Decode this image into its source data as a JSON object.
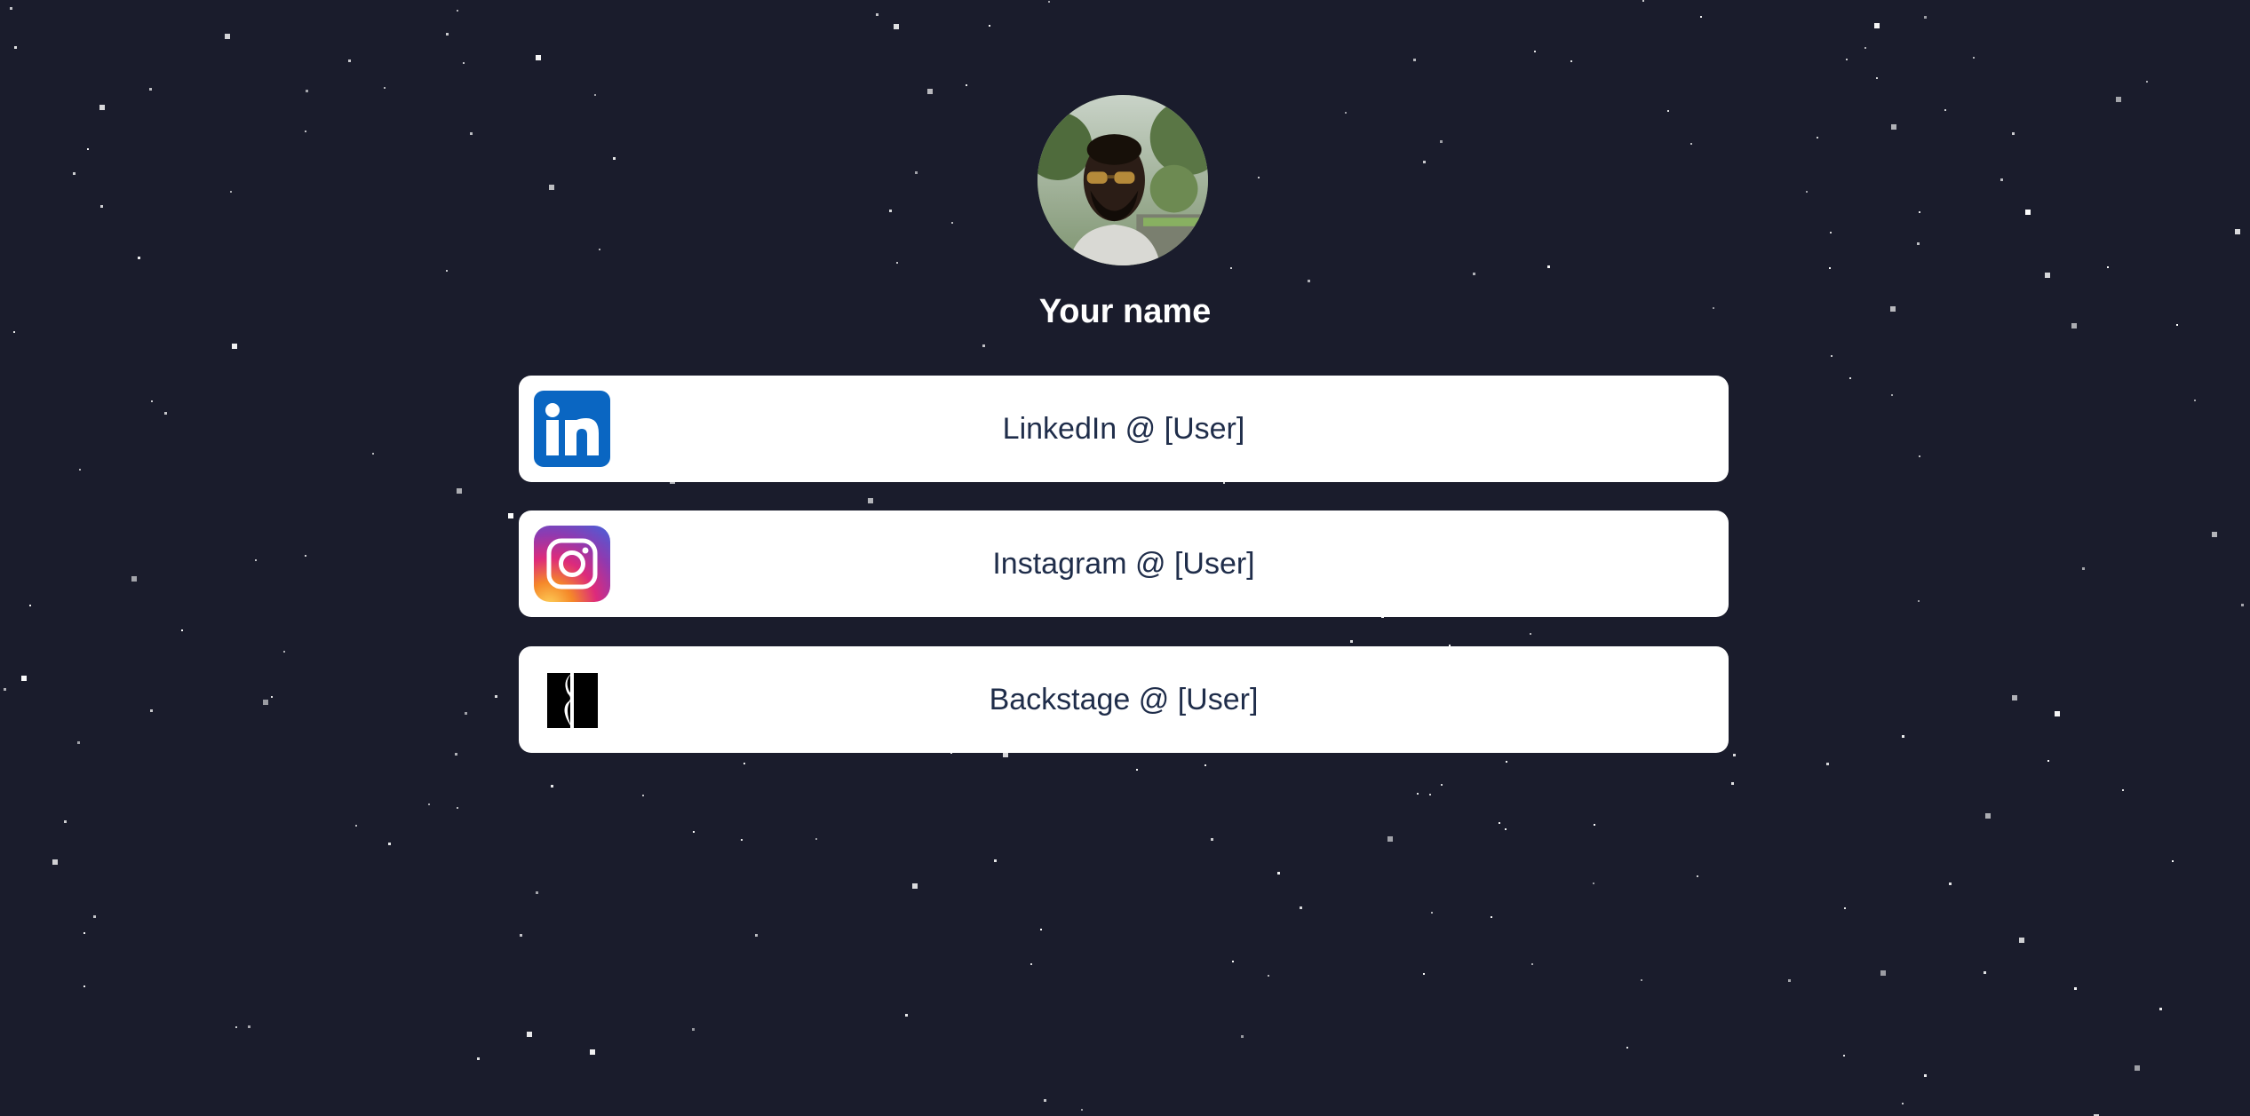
{
  "colors": {
    "background": "#1a1c2c",
    "card_background": "#ffffff",
    "card_text": "#1f2d4a",
    "name_text": "#ffffff",
    "linkedin_blue": "#0a66c2"
  },
  "profile": {
    "name": "Your name",
    "avatar_icon": "profile-photo"
  },
  "links": [
    {
      "label": "LinkedIn @ [User]",
      "icon": "linkedin-icon"
    },
    {
      "label": "Instagram @ [User]",
      "icon": "instagram-icon"
    },
    {
      "label": "Backstage @ [User]",
      "icon": "backstage-icon"
    }
  ]
}
